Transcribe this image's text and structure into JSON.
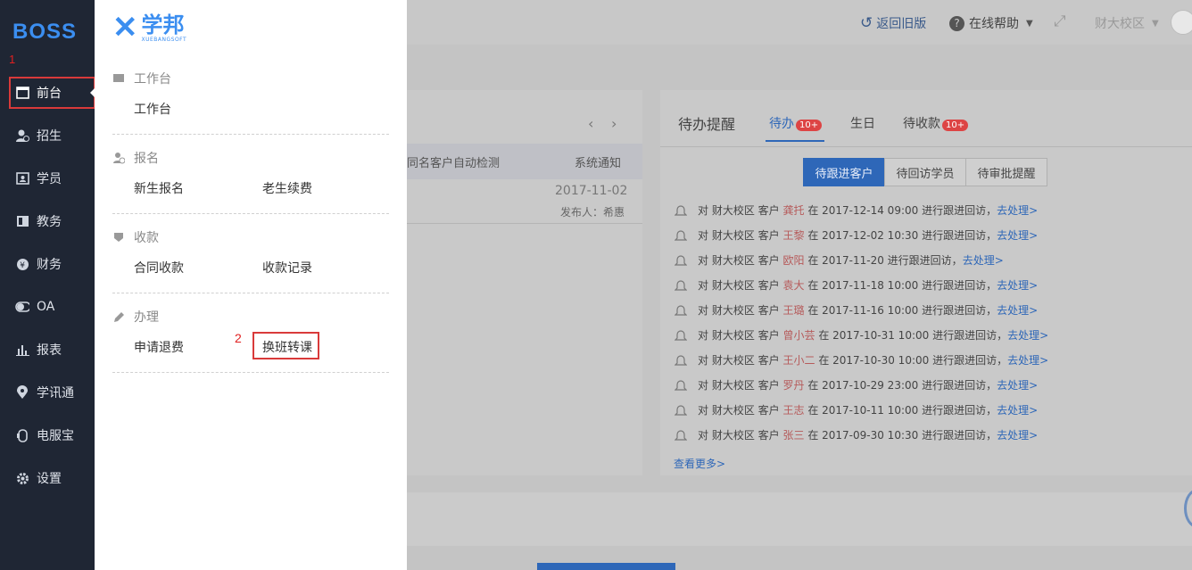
{
  "sidebar": {
    "logo": "BOSS",
    "items": [
      {
        "label": "前台",
        "icon": "calendar-icon"
      },
      {
        "label": "招生",
        "icon": "user-add-icon"
      },
      {
        "label": "学员",
        "icon": "id-card-icon"
      },
      {
        "label": "教务",
        "icon": "book-icon"
      },
      {
        "label": "财务",
        "icon": "yen-coin-icon"
      },
      {
        "label": "OA",
        "icon": "toggle-icon"
      },
      {
        "label": "报表",
        "icon": "bar-chart-icon"
      },
      {
        "label": "学讯通",
        "icon": "location-pin-icon"
      },
      {
        "label": "电服宝",
        "icon": "phone-icon"
      },
      {
        "label": "设置",
        "icon": "gear-icon"
      }
    ]
  },
  "annotations": {
    "marker1": "1",
    "marker2": "2"
  },
  "flyout": {
    "brand_cn": "学邦",
    "brand_en": "XUEBANGSOFT",
    "sections": [
      {
        "title": "工作台",
        "icon": "monitor-icon",
        "links": [
          "工作台"
        ]
      },
      {
        "title": "报名",
        "icon": "user-add-icon",
        "links": [
          "新生报名",
          "老生续费"
        ]
      },
      {
        "title": "收款",
        "icon": "money-icon",
        "links": [
          "合同收款",
          "收款记录"
        ]
      },
      {
        "title": "办理",
        "icon": "pencil-icon",
        "links": [
          "申请退费",
          "换班转课"
        ]
      }
    ]
  },
  "header": {
    "back_label": "返回旧版",
    "help_label": "在线帮助",
    "campus_label": "财大校区"
  },
  "notice_panel": {
    "title_fragment": "同名客户自动检测",
    "type": "系统通知",
    "date": "2017-11-02",
    "publisher": "发布人：希惠"
  },
  "todo_panel": {
    "title": "待办提醒",
    "tabs": [
      {
        "label": "待办",
        "badge": "10+"
      },
      {
        "label": "生日",
        "badge": ""
      },
      {
        "label": "待收款",
        "badge": "10+"
      }
    ],
    "segments": [
      "待跟进客户",
      "待回访学员",
      "待审批提醒"
    ],
    "items": [
      {
        "prefix": "对 财大校区 客户",
        "name": "龚托",
        "text": "在 2017-12-14 09:00 进行跟进回访，",
        "action": "去处理>"
      },
      {
        "prefix": "对 财大校区 客户",
        "name": "王黎",
        "text": "在 2017-12-02 10:30 进行跟进回访，",
        "action": "去处理>"
      },
      {
        "prefix": "对 财大校区 客户",
        "name": "欧阳",
        "text": "在 2017-11-20 进行跟进回访，",
        "action": "去处理>"
      },
      {
        "prefix": "对 财大校区 客户",
        "name": "袁大",
        "text": "在 2017-11-18 10:00 进行跟进回访，",
        "action": "去处理>"
      },
      {
        "prefix": "对 财大校区 客户",
        "name": "王璐",
        "text": "在 2017-11-16 10:00 进行跟进回访，",
        "action": "去处理>"
      },
      {
        "prefix": "对 财大校区 客户",
        "name": "曾小芸",
        "text": "在 2017-10-31 10:00 进行跟进回访，",
        "action": "去处理>"
      },
      {
        "prefix": "对 财大校区 客户",
        "name": "王小二",
        "text": "在 2017-10-30 10:00 进行跟进回访，",
        "action": "去处理>"
      },
      {
        "prefix": "对 财大校区 客户",
        "name": "罗丹",
        "text": "在 2017-10-29 23:00 进行跟进回访，",
        "action": "去处理>"
      },
      {
        "prefix": "对 财大校区 客户",
        "name": "王志",
        "text": "在 2017-10-11 10:00 进行跟进回访，",
        "action": "去处理>"
      },
      {
        "prefix": "对 财大校区 客户",
        "name": "张三",
        "text": "在 2017-09-30 10:30 进行跟进回访，",
        "action": "去处理>"
      }
    ],
    "more": "查看更多>"
  }
}
